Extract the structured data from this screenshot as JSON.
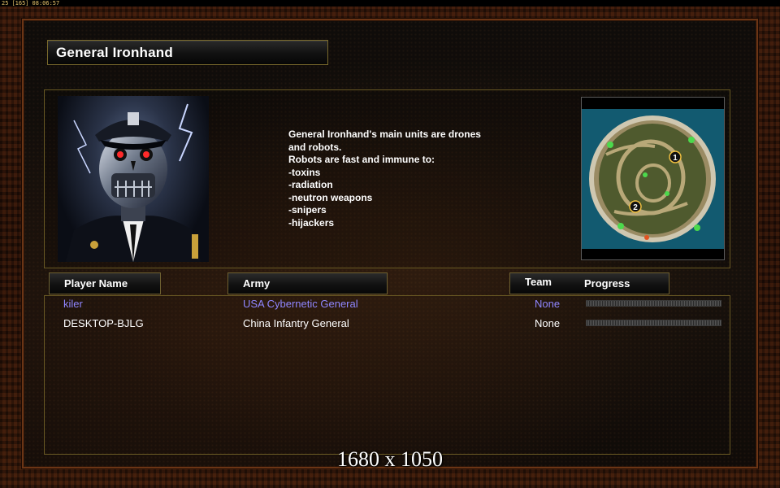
{
  "status_bar": {
    "fps": "25",
    "counter": "[165]",
    "clock": "08:06:57"
  },
  "general": {
    "name": "General Ironhand",
    "description": "General Ironhand's main units are drones\n and robots.\nRobots are fast and immune to:\n-toxins\n-radiation\n-neutron weapons\n-snipers\n-hijackers"
  },
  "minimap": {
    "markers": [
      "1",
      "2"
    ]
  },
  "columns": {
    "player_name": "Player Name",
    "army": "Army",
    "team": "Team",
    "progress": "Progress"
  },
  "players": [
    {
      "name": "kiler",
      "army": "USA Cybernetic General",
      "team": "None",
      "color": "#8f86ff",
      "progress": 0
    },
    {
      "name": "DESKTOP-BJLG",
      "army": "China Infantry General",
      "team": "None",
      "color": "#ffffff",
      "progress": 0
    }
  ],
  "watermark": "1680 x 1050",
  "colors": {
    "frame_rust": "#3a1a0c",
    "panel_border": "#6a5a24",
    "local_player": "#8f86ff"
  }
}
